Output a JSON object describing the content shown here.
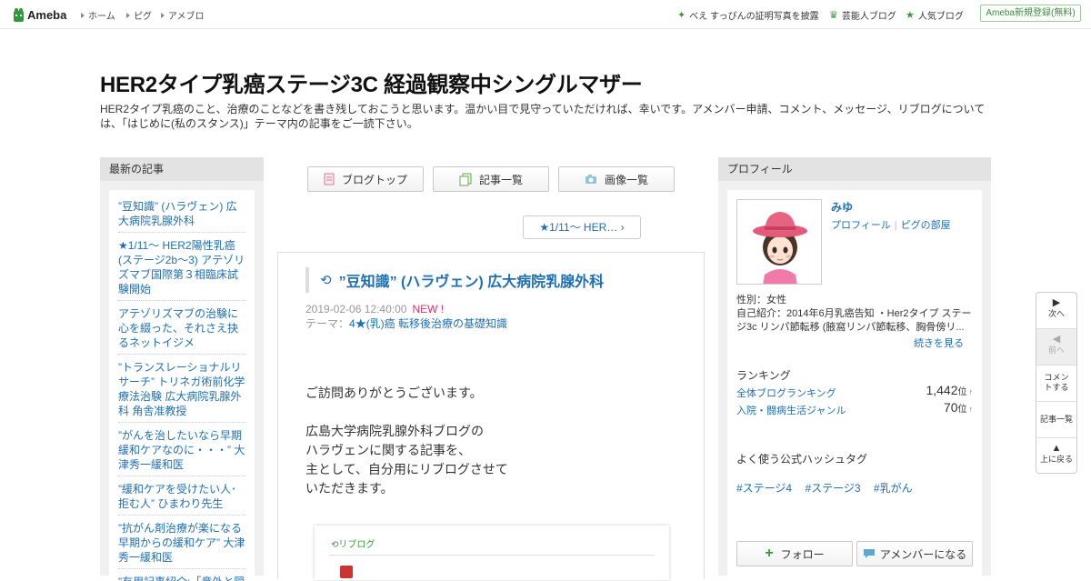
{
  "header": {
    "logo": "Ameba",
    "nav": [
      "ホーム",
      "ピグ",
      "アメブロ"
    ],
    "right_links": [
      {
        "icon": "sparkle-icon",
        "label": "べえ すっぴんの証明写真を披露"
      },
      {
        "icon": "crown-icon",
        "label": "芸能人ブログ"
      },
      {
        "icon": "star-icon",
        "label": "人気ブログ"
      }
    ],
    "register": "Ameba新規登録(無料)"
  },
  "blog": {
    "title": "HER2タイプ乳癌ステージ3C 経過観察中シングルマザー",
    "description": "HER2タイプ乳癌のこと、治療のことなどを書き残しておこうと思います。温かい目で見守っていただければ、幸いです。アメンバー申請、コメント、メッセージ、リブログについては、「はじめに(私のスタンス)」テーマ内の記事をご一読下さい。"
  },
  "left": {
    "heading": "最新の記事",
    "items": [
      "”豆知識” (ハラヴェン) 広大病院乳腺外科",
      "★1/11～ HER2陽性乳癌(ステージ2b～3) アテゾリズマブ国際第３相臨床試験開始",
      "アテゾリズマブの治験に心を綴った、それさえ抉るネットイジメ",
      "”トランスレーショナルリサーチ” トリネガ術前化学療法治験 広大病院乳腺外科 角舎准教授",
      "”がんを治したいなら早期緩和ケアなのに・・・” 大津秀一緩和医",
      "”緩和ケアを受けたい人･拒む人” ひまわり先生",
      "”抗がん剤治療が楽になる早期からの緩和ケア” 大津秀一緩和医",
      "”有用記事紹介:「意外と隠している人が多いのだと"
    ]
  },
  "tabs": [
    {
      "icon": "document-icon",
      "label": "ブログトップ"
    },
    {
      "icon": "list-icon",
      "label": "記事一覧"
    },
    {
      "icon": "camera-icon",
      "label": "画像一覧"
    }
  ],
  "next_article": "★1/11～ HER…",
  "article": {
    "title": "”豆知識” (ハラヴェン) 広大病院乳腺外科",
    "datetime": "2019-02-06 12:40:00",
    "new_badge": "NEW !",
    "theme_label": "テーマ：",
    "theme": "4★(乳)癌 転移後治療の基礎知識",
    "body": [
      "ご訪問ありがとうございます。",
      "",
      "広島大学病院乳腺外科ブログの",
      "ハラヴェンに関する記事を、",
      "主として、自分用にリブログさせて",
      "いただきます。"
    ],
    "reblog_label": "リブログ"
  },
  "profile": {
    "heading": "プロフィール",
    "name": "みゆ",
    "link_profile": "プロフィール",
    "link_pigg": "ピグの部屋",
    "gender": "性別：女性",
    "intro": "自己紹介：2014年6月乳癌告知 ・Her2タイプ ステージ3c リンパ節転移 (腋窩リンパ節転移、胸骨傍リ...",
    "more": "続きを見る",
    "ranking_heading": "ランキング",
    "rankings": [
      {
        "name": "全体ブログランキング",
        "value": "1,442",
        "unit": "位",
        "trend": "↑"
      },
      {
        "name": "入院・闘病生活ジャンル",
        "value": "70",
        "unit": "位",
        "trend": "↑"
      }
    ],
    "hashtag_heading": "よく使う公式ハッシュタグ",
    "hashtags": [
      "#ステージ4",
      "#ステージ3",
      "#乳がん"
    ],
    "follow": "フォロー",
    "amember": "アメンバーになる"
  },
  "sidenav": [
    {
      "icon": "play-icon",
      "label": "次へ",
      "enabled": true
    },
    {
      "icon": "back-icon",
      "label": "前へ",
      "enabled": false
    },
    {
      "icon": "",
      "label": "コメントする",
      "enabled": true
    },
    {
      "icon": "",
      "label": "記事一覧",
      "enabled": true
    },
    {
      "icon": "up-icon",
      "label": "上に戻る",
      "enabled": true
    }
  ]
}
